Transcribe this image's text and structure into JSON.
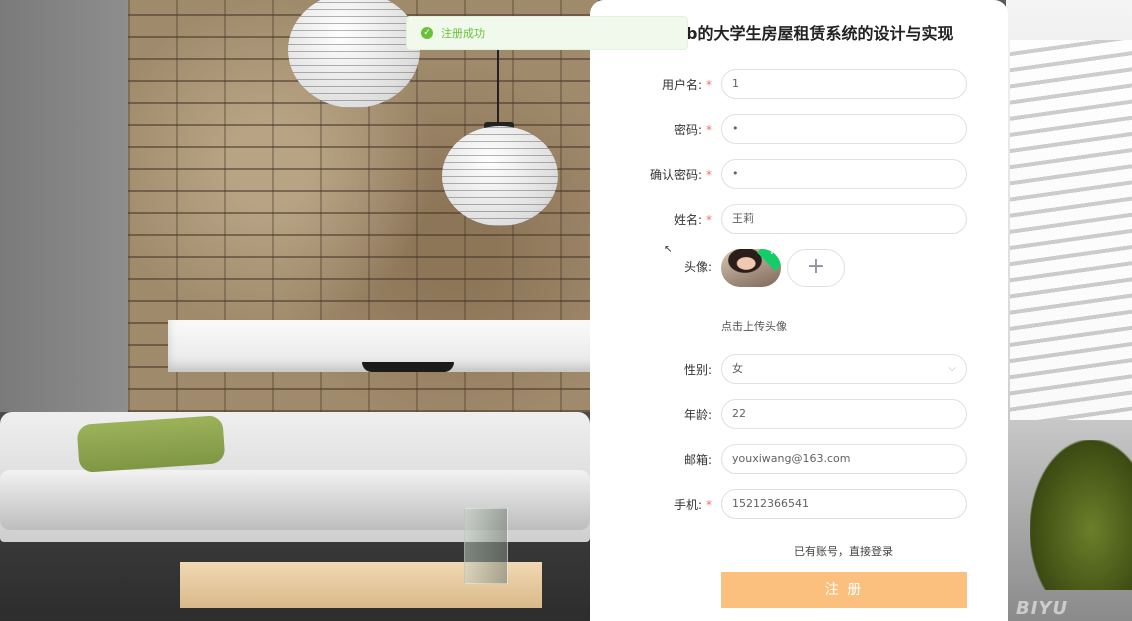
{
  "toast": {
    "icon": "check-circle-icon",
    "message": "注册成功",
    "color": "#67c23a"
  },
  "header": {
    "title": "b的大学生房屋租赁系统的设计与实现"
  },
  "form": {
    "username": {
      "label": "用户名:",
      "required": true,
      "value": "1"
    },
    "password": {
      "label": "密码:",
      "required": true,
      "value": "•"
    },
    "confirm_password": {
      "label": "确认密码:",
      "required": true,
      "value": "•"
    },
    "name": {
      "label": "姓名:",
      "required": true,
      "value": "王莉"
    },
    "avatar": {
      "label": "头像:",
      "upload_hint": "点击上传头像",
      "add_icon": "+"
    },
    "gender": {
      "label": "性别:",
      "value": "女"
    },
    "age": {
      "label": "年龄:",
      "value": "22"
    },
    "email": {
      "label": "邮箱:",
      "value": "youxiwang@163.com"
    },
    "phone": {
      "label": "手机:",
      "required": true,
      "value": "15212366541"
    },
    "required_mark": "*"
  },
  "footer": {
    "login_link": "已有账号，直接登录",
    "submit_label": "注 册",
    "submit_color": "#fbc07d"
  },
  "watermark": "BIYU"
}
